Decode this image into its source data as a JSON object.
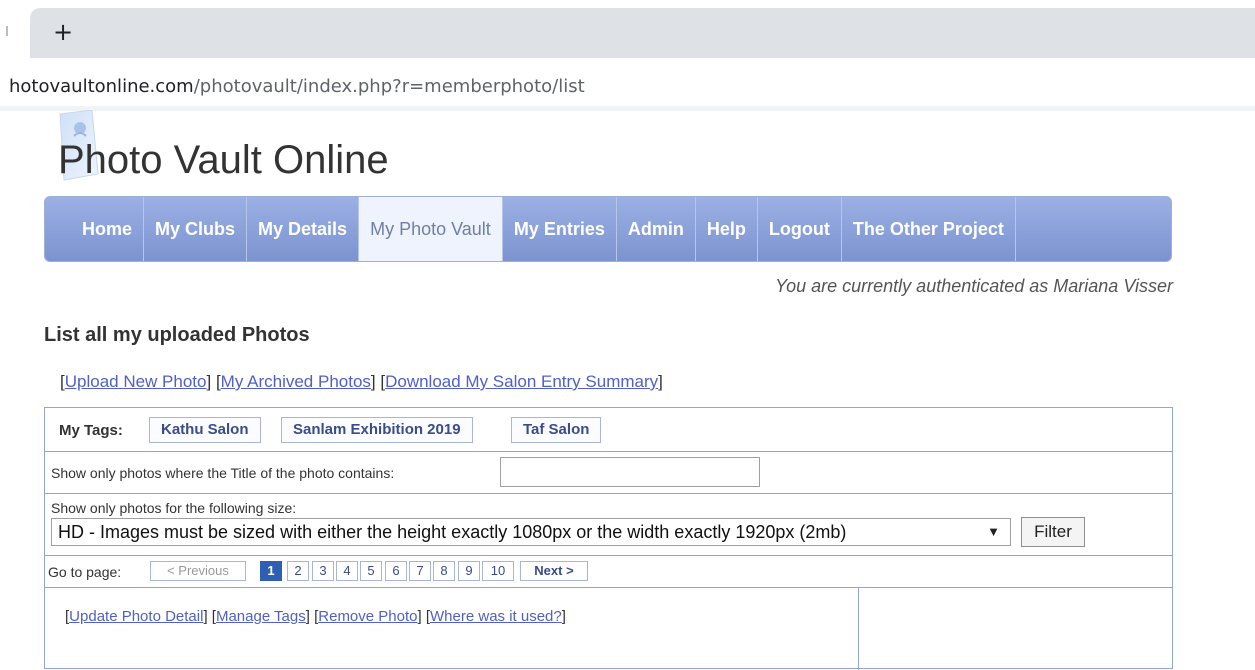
{
  "browser": {
    "new_tab_glyph": "+",
    "url_host": "hotovaultonline.com",
    "url_path": "/photovault/index.php?r=memberphoto/list"
  },
  "site": {
    "title": "Photo Vault Online",
    "logo_icon": "camera-logo-icon"
  },
  "nav": {
    "items": [
      {
        "label": "Home"
      },
      {
        "label": "My Clubs"
      },
      {
        "label": "My Details"
      },
      {
        "label": "My Photo Vault",
        "active": true
      },
      {
        "label": "My Entries"
      },
      {
        "label": "Admin"
      },
      {
        "label": "Help"
      },
      {
        "label": "Logout"
      },
      {
        "label": "The Other Project"
      }
    ]
  },
  "auth_text": "You are currently authenticated as Mariana Visser",
  "page_heading": "List all my uploaded Photos",
  "top_links": {
    "upload": "Upload New Photo",
    "archived": "My Archived Photos",
    "download": "Download My Salon Entry Summary"
  },
  "tags": {
    "label": "My Tags:",
    "items": [
      "Kathu Salon",
      "Sanlam Exhibition 2019",
      "Taf Salon"
    ]
  },
  "title_filter": {
    "label": "Show only photos where the Title of the photo contains:",
    "value": ""
  },
  "size_filter": {
    "label": "Show only photos for the following size:",
    "selected": "HD - Images must be sized with either the height exactly 1080px or the width exactly 1920px (2mb)",
    "arrow": "▼",
    "button": "Filter"
  },
  "pager": {
    "label": "Go to page:",
    "prev": "< Previous",
    "pages": [
      "1",
      "2",
      "3",
      "4",
      "5",
      "6",
      "7",
      "8",
      "9",
      "10"
    ],
    "current": "1",
    "next": "Next >"
  },
  "photo_actions": {
    "update": "Update Photo Detail",
    "tags": "Manage Tags",
    "remove": "Remove Photo",
    "where": "Where was it used?"
  },
  "colors": {
    "nav_bg": "#8ea3db",
    "link": "#5060c8",
    "border": "#93a6cf",
    "current_page": "#2f5fb3"
  }
}
